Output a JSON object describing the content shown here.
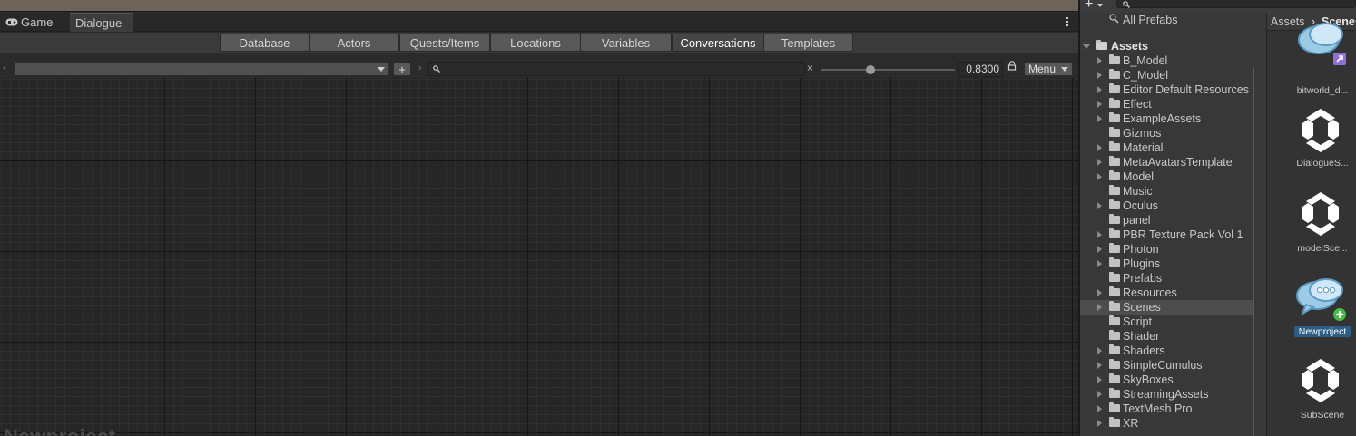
{
  "window_tabs": [
    {
      "label": "Game",
      "icon": "gamepad-icon"
    },
    {
      "label": "Dialogue"
    }
  ],
  "database_tabs": [
    "Database",
    "Actors",
    "Quests/Items",
    "Locations",
    "Variables",
    "Conversations",
    "Templates"
  ],
  "active_database_tab": "Conversations",
  "toolbar": {
    "conversation_selected": "",
    "add_label": "+",
    "search_value": "",
    "clear_label": "×",
    "zoom_value": "0.8300",
    "zoom_fraction": 0.36,
    "menu_label": "Menu"
  },
  "canvas": {
    "overlay_title": "Newproject"
  },
  "project": {
    "create_label": "+",
    "search_value": "",
    "favorites_item": "All Prefabs",
    "root_label": "Assets",
    "folders": [
      {
        "label": "B_Model",
        "expandable": true
      },
      {
        "label": "C_Model",
        "expandable": true
      },
      {
        "label": "Editor Default Resources",
        "expandable": true
      },
      {
        "label": "Effect",
        "expandable": true
      },
      {
        "label": "ExampleAssets",
        "expandable": true
      },
      {
        "label": "Gizmos",
        "expandable": false
      },
      {
        "label": "Material",
        "expandable": true
      },
      {
        "label": "MetaAvatarsTemplate",
        "expandable": true
      },
      {
        "label": "Model",
        "expandable": true
      },
      {
        "label": "Music",
        "expandable": false
      },
      {
        "label": "Oculus",
        "expandable": true
      },
      {
        "label": "panel",
        "expandable": false
      },
      {
        "label": "PBR Texture Pack Vol 1",
        "expandable": true
      },
      {
        "label": "Photon",
        "expandable": true
      },
      {
        "label": "Plugins",
        "expandable": true
      },
      {
        "label": "Prefabs",
        "expandable": false
      },
      {
        "label": "Resources",
        "expandable": true
      },
      {
        "label": "Scenes",
        "expandable": true,
        "selected": true
      },
      {
        "label": "Script",
        "expandable": false
      },
      {
        "label": "Shader",
        "expandable": false
      },
      {
        "label": "Shaders",
        "expandable": true
      },
      {
        "label": "SimpleCumulus",
        "expandable": true
      },
      {
        "label": "SkyBoxes",
        "expandable": true
      },
      {
        "label": "StreamingAssets",
        "expandable": true
      },
      {
        "label": "TextMesh Pro",
        "expandable": true
      },
      {
        "label": "XR",
        "expandable": true
      }
    ],
    "breadcrumb": [
      "Assets",
      "Scenes"
    ],
    "assets": [
      {
        "name": "bitworld_d...",
        "icon": "dialogue-database-icon"
      },
      {
        "name": "DialogueS...",
        "icon": "unity-scene-icon"
      },
      {
        "name": "modelSce...",
        "icon": "unity-scene-icon"
      },
      {
        "name": "Newproject",
        "icon": "dialogue-database-icon",
        "selected": true
      },
      {
        "name": "SubScene",
        "icon": "unity-scene-icon"
      }
    ]
  },
  "colors": {
    "selection": "#2c5d87",
    "panel": "#383838",
    "canvas": "#262626"
  }
}
